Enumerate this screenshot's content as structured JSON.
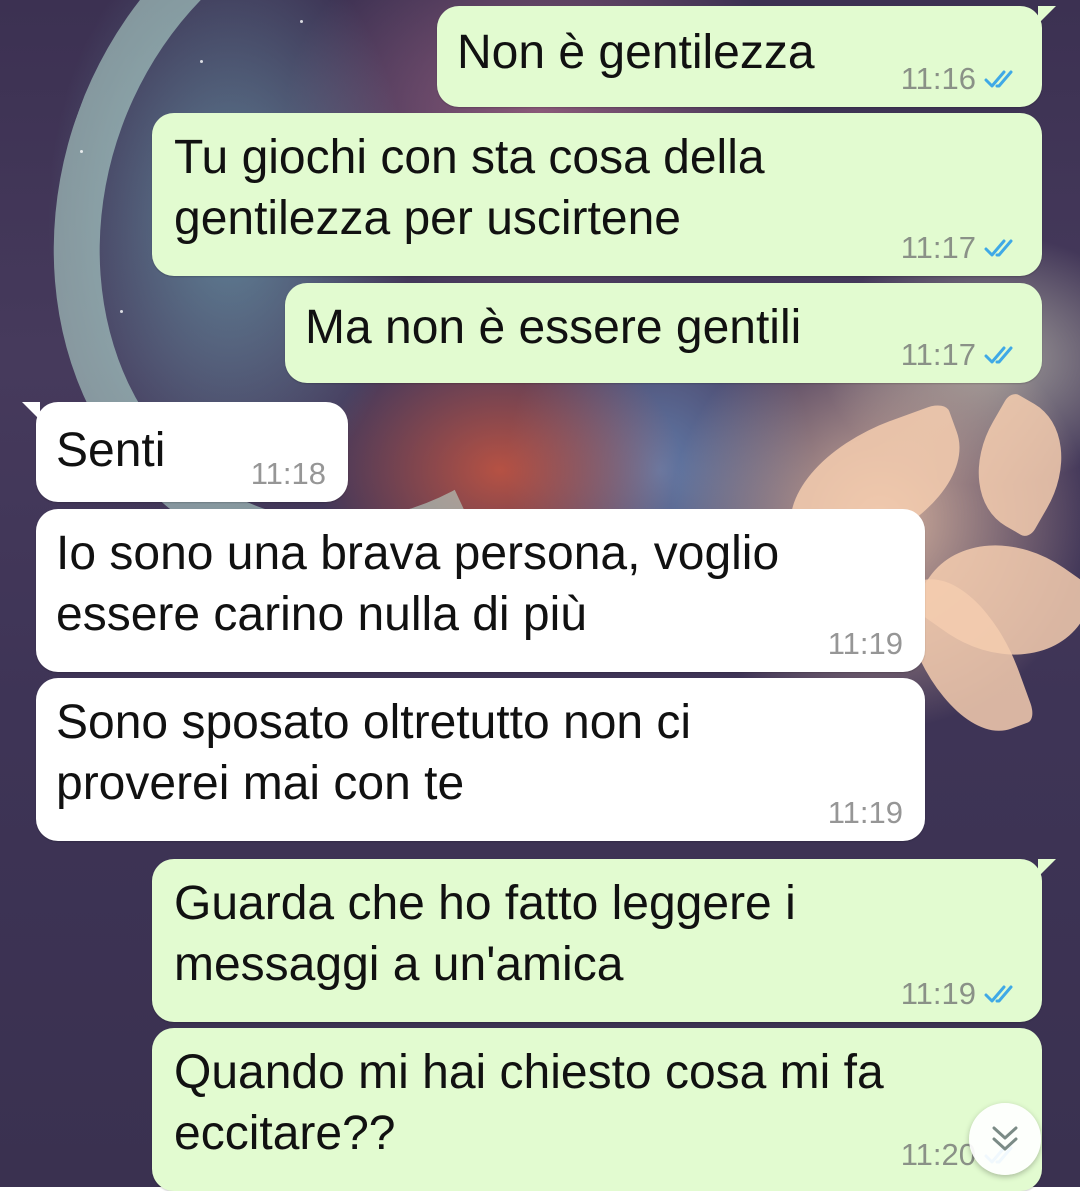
{
  "messages": [
    {
      "direction": "out",
      "text": "Non è gentilezza",
      "time": "11:16",
      "read": true
    },
    {
      "direction": "out",
      "text": "Tu giochi con sta cosa della\ngentilezza per uscirtene",
      "time": "11:17",
      "read": true
    },
    {
      "direction": "out",
      "text": "Ma non è essere gentili",
      "time": "11:17",
      "read": true
    },
    {
      "direction": "in",
      "text": "Senti",
      "time": "11:18"
    },
    {
      "direction": "in",
      "text": "Io sono una brava persona, voglio\nessere carino nulla di più",
      "time": "11:19"
    },
    {
      "direction": "in",
      "text": "Sono sposato oltretutto non ci\nproverei mai con te",
      "time": "11:19"
    },
    {
      "direction": "out",
      "text": "Guarda che ho fatto leggere i\nmessaggi a un'amica",
      "time": "11:19",
      "read": true
    },
    {
      "direction": "out",
      "text": "Quando mi hai chiesto cosa mi fa\neccitare??",
      "time": "11:20",
      "read": true
    }
  ],
  "icons": {
    "read_receipt": "double-check-icon",
    "scroll_down": "double-chevron-down-icon"
  },
  "colors": {
    "outgoing_bubble": "#e2fbd0",
    "incoming_bubble": "#ffffff",
    "read_tick": "#3fa9e6",
    "timestamp": "#8a9187"
  }
}
